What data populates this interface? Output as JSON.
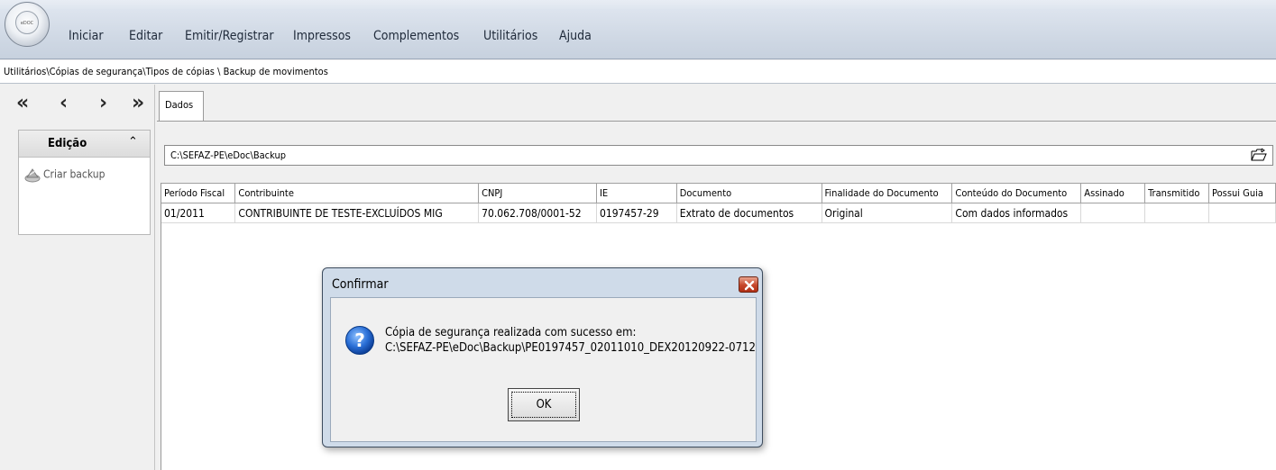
{
  "menu": {
    "app_logo_text": "eDOC",
    "items": [
      "Iniciar",
      "Editar",
      "Emitir/Registrar",
      "Impressos",
      "Complementos",
      "Utilitários",
      "Ajuda"
    ]
  },
  "breadcrumb": "Utilitários\\Cópias de segurança\\Tipos de cópias \\ Backup de movimentos",
  "sidebar": {
    "nav": [
      "«",
      "‹",
      "›",
      "»"
    ],
    "section_title": "Edição",
    "collapse_icon": "double-chevron-up-icon",
    "items": [
      {
        "label": "Criar backup",
        "icon": "backup-icon"
      }
    ]
  },
  "tabs": [
    {
      "label": "Dados"
    }
  ],
  "path_field": {
    "value": "C:\\SEFAZ-PE\\eDoc\\Backup",
    "icon": "folder-open-icon"
  },
  "table": {
    "columns": [
      "Período Fiscal",
      "Contribuinte",
      "CNPJ",
      "IE",
      "Documento",
      "Finalidade do Documento",
      "Conteúdo do Documento",
      "Assinado",
      "Transmitido",
      "Possui Guia"
    ],
    "rows": [
      [
        "01/2011",
        "CONTRIBUINTE DE TESTE-EXCLUÍDOS MIG",
        "70.062.708/0001-52",
        "0197457-29",
        "Extrato de documentos",
        "Original",
        "Com dados informados",
        "",
        "",
        ""
      ]
    ]
  },
  "dialog": {
    "title": "Confirmar",
    "icon": "question-icon",
    "message_line1": "Cópia de segurança realizada com sucesso em:",
    "message_line2": "C:\\SEFAZ-PE\\eDoc\\Backup\\PE0197457_02011010_DEX20120922-0712",
    "ok_label": "OK"
  }
}
